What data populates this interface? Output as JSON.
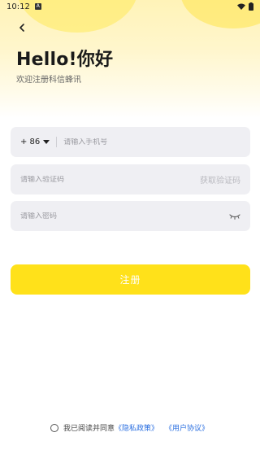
{
  "status_bar": {
    "time": "10:12",
    "badge": "A"
  },
  "header": {
    "title": "Hello!你好",
    "subtitle": "欢迎注册科信蜂讯"
  },
  "form": {
    "country_code": "+ 86",
    "phone_placeholder": "请输入手机号",
    "code_placeholder": "请输入验证码",
    "get_code_label": "获取验证码",
    "password_placeholder": "请输入密码"
  },
  "register_label": "注册",
  "agreement": {
    "prefix": "我已阅读并同意",
    "privacy_link": "《隐私政策》",
    "user_link": "《用户协议》"
  },
  "colors": {
    "accent": "#ffe11a",
    "link": "#2b6fe0",
    "field_bg": "#efeff3"
  }
}
